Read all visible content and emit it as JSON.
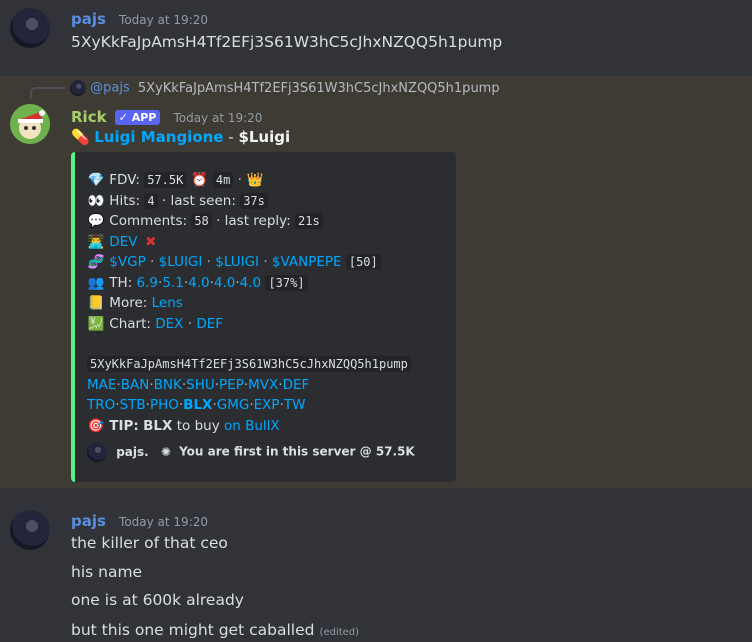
{
  "messages": [
    {
      "author": "pajs",
      "timestamp": "Today at 19:20",
      "text": "5XyKkFaJpAmsH4Tf2EFj3S61W3hC5cJhxNZQQ5h1pump"
    }
  ],
  "reply": {
    "ref_author": "@pajs",
    "ref_text": "5XyKkFaJpAmsH4Tf2EFj3S61W3hC5cJhxNZQQ5h1pump"
  },
  "bot": {
    "author": "Rick",
    "badge": "APP",
    "timestamp": "Today at 19:20",
    "title_link": "Luigi Mangione",
    "title_sep": " - ",
    "title_ticker": "$Luigi",
    "embed": {
      "fdv_label": "FDV:",
      "fdv_value": "57.5K",
      "age": "4m",
      "hits_label": "Hits:",
      "hits_value": "4",
      "last_seen_label": "· last seen:",
      "last_seen_value": "37s",
      "comments_label": "Comments:",
      "comments_value": "58",
      "last_reply_label": "· last reply:",
      "last_reply_value": "21s",
      "dev_label": "DEV",
      "tickers": [
        "$VGP",
        "$LUIGI",
        "$LUIGI",
        "$VANPEPE"
      ],
      "tickers_count": "[50]",
      "th_label": "TH:",
      "th_values": [
        "6.9",
        "5.1",
        "4.0",
        "4.0",
        "4.0"
      ],
      "th_pct": "[37%]",
      "more_label": "More:",
      "more_link": "Lens",
      "chart_label": "Chart:",
      "chart_links": [
        "DEX",
        "DEF"
      ],
      "contract": "5XyKkFaJpAmsH4Tf2EFj3S61W3hC5cJhxNZQQ5h1pump",
      "links_row1": [
        "MAE",
        "BAN",
        "BNK",
        "SHU",
        "PEP",
        "MVX",
        "DEF"
      ],
      "links_row2": [
        "TRO",
        "STB",
        "PHO",
        "BLX",
        "GMG",
        "EXP",
        "TW"
      ],
      "tip_label": "TIP:",
      "tip_bold": "BLX",
      "tip_text": "to buy",
      "tip_link": "on BullX",
      "footer_author": "pajs.",
      "footer_text": "You are first in this server @ 57.5K"
    }
  },
  "message3": {
    "author": "pajs",
    "timestamp": "Today at 19:20",
    "lines": [
      "the killer of that ceo",
      "his name",
      "one is at 600k already",
      "but this one might get caballed"
    ],
    "edited": "(edited)"
  },
  "colors": {
    "background": "#313338",
    "highlight": "#3e3b34",
    "embed_bg": "#2b2d31",
    "embed_border": "#57f287",
    "link": "#00a8fc",
    "bot_name": "#a4d16b",
    "user_name": "#5b8de0"
  }
}
